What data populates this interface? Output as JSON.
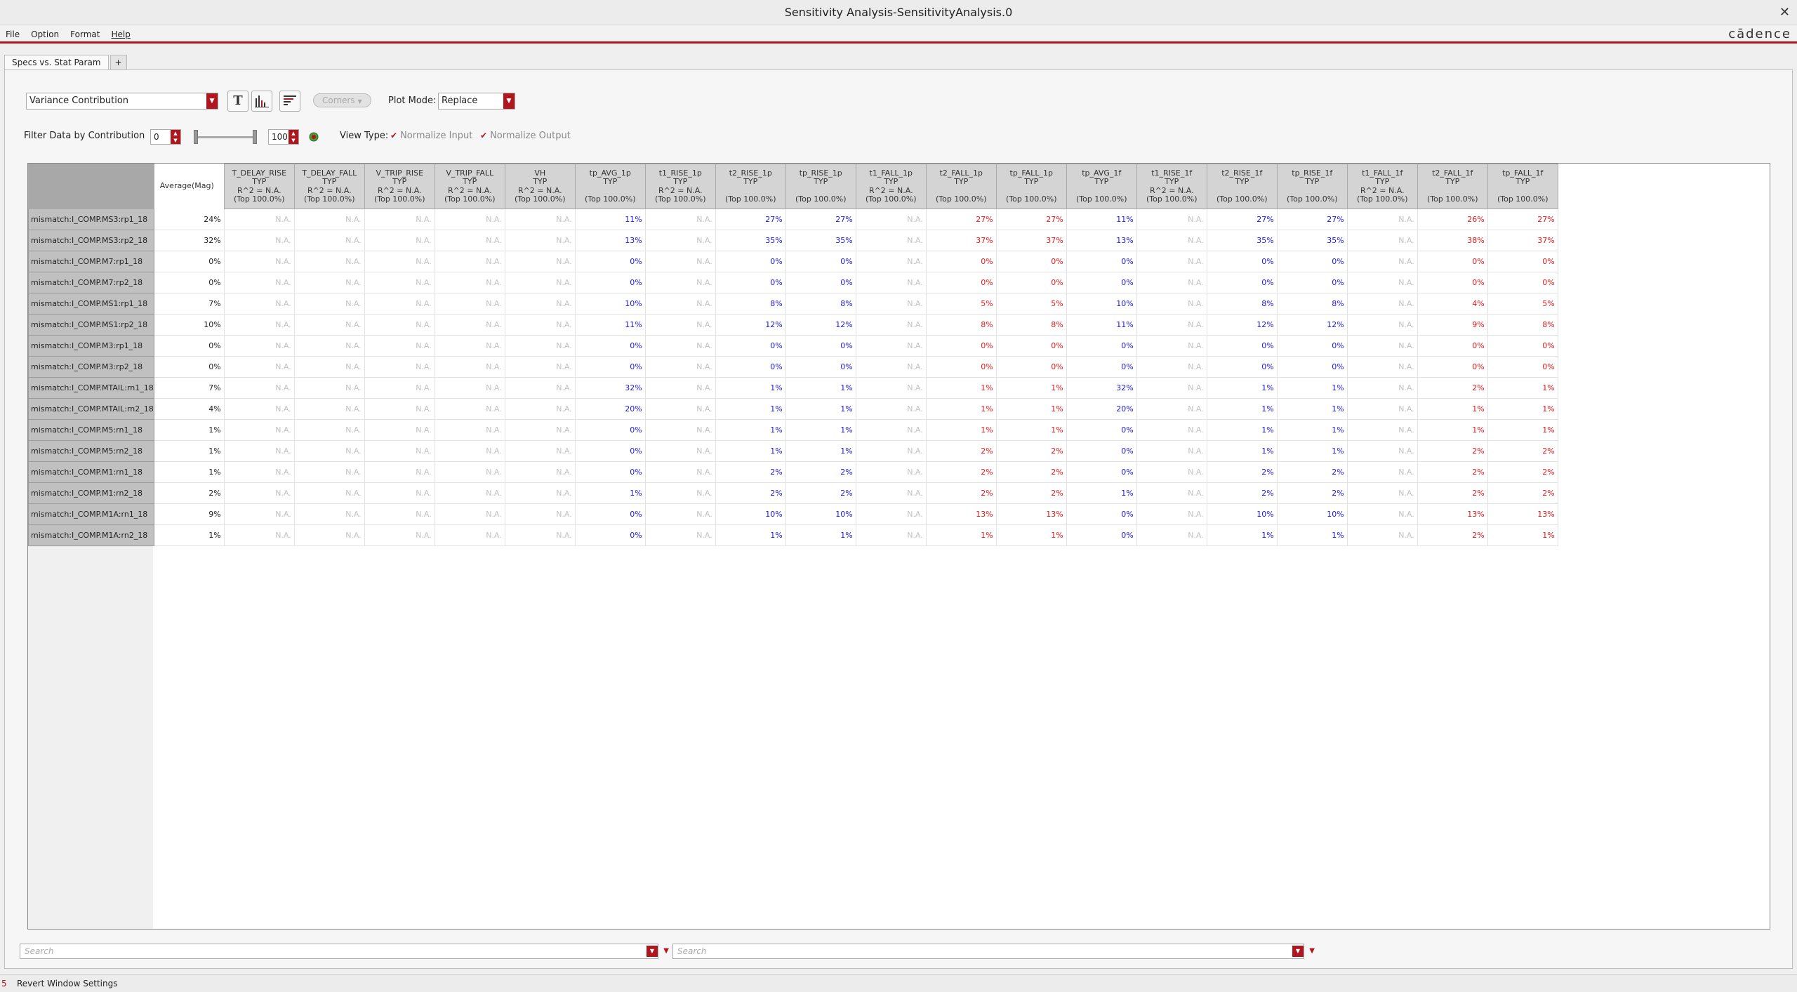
{
  "window": {
    "title": "Sensitivity Analysis-SensitivityAnalysis.0",
    "brand": "cādence"
  },
  "menu": [
    "File",
    "Option",
    "Format",
    "Help"
  ],
  "tabs": [
    "Specs vs. Stat Param",
    "+"
  ],
  "toolbar": {
    "mode_select": "Variance Contribution",
    "corners_label": "Corners",
    "plot_mode_label": "Plot Mode:",
    "plot_mode_value": "Replace",
    "text_view_icon": "T",
    "bar_chart_icon": "bar-chart-icon",
    "sorted_bars_icon": "sorted-bars-icon"
  },
  "filter": {
    "label": "Filter Data  by Contribution",
    "min": "0",
    "max": "100",
    "view_type_label": "View Type:",
    "normalize_input": "Normalize Input",
    "normalize_output": "Normalize Output"
  },
  "grid": {
    "avg_header": "Average(Mag)",
    "columns": [
      {
        "l1": "T_DELAY_RISE",
        "l2": "TYP",
        "l3": "R^2 = N.A.",
        "l4": "(Top 100.0%)"
      },
      {
        "l1": "T_DELAY_FALL",
        "l2": "TYP",
        "l3": "R^2 = N.A.",
        "l4": "(Top 100.0%)"
      },
      {
        "l1": "V_TRIP_RISE",
        "l2": "TYP",
        "l3": "R^2 = N.A.",
        "l4": "(Top 100.0%)"
      },
      {
        "l1": "V_TRIP_FALL",
        "l2": "TYP",
        "l3": "R^2 = N.A.",
        "l4": "(Top 100.0%)"
      },
      {
        "l1": "VH",
        "l2": "TYP",
        "l3": "R^2 = N.A.",
        "l4": "(Top 100.0%)"
      },
      {
        "l1": "tp_AVG_1p",
        "l2": "TYP",
        "l3": "",
        "l4": "(Top 100.0%)"
      },
      {
        "l1": "t1_RISE_1p",
        "l2": "TYP",
        "l3": "R^2 = N.A.",
        "l4": "(Top 100.0%)"
      },
      {
        "l1": "t2_RISE_1p",
        "l2": "TYP",
        "l3": "",
        "l4": "(Top 100.0%)"
      },
      {
        "l1": "tp_RISE_1p",
        "l2": "TYP",
        "l3": "",
        "l4": "(Top 100.0%)"
      },
      {
        "l1": "t1_FALL_1p",
        "l2": "TYP",
        "l3": "R^2 = N.A.",
        "l4": "(Top 100.0%)"
      },
      {
        "l1": "t2_FALL_1p",
        "l2": "TYP",
        "l3": "",
        "l4": "(Top 100.0%)"
      },
      {
        "l1": "tp_FALL_1p",
        "l2": "TYP",
        "l3": "",
        "l4": "(Top 100.0%)"
      },
      {
        "l1": "tp_AVG_1f",
        "l2": "TYP",
        "l3": "",
        "l4": "(Top 100.0%)"
      },
      {
        "l1": "t1_RISE_1f",
        "l2": "TYP",
        "l3": "R^2 = N.A.",
        "l4": "(Top 100.0%)"
      },
      {
        "l1": "t2_RISE_1f",
        "l2": "TYP",
        "l3": "",
        "l4": "(Top 100.0%)"
      },
      {
        "l1": "tp_RISE_1f",
        "l2": "TYP",
        "l3": "",
        "l4": "(Top 100.0%)"
      },
      {
        "l1": "t1_FALL_1f",
        "l2": "TYP",
        "l3": "R^2 = N.A.",
        "l4": "(Top 100.0%)"
      },
      {
        "l1": "t2_FALL_1f",
        "l2": "TYP",
        "l3": "",
        "l4": "(Top 100.0%)"
      },
      {
        "l1": "tp_FALL_1f",
        "l2": "TYP",
        "l3": "",
        "l4": "(Top 100.0%)"
      }
    ],
    "col_colors": [
      "na",
      "na",
      "na",
      "na",
      "na",
      "pos",
      "na",
      "pos",
      "pos",
      "na",
      "neg",
      "neg",
      "pos",
      "na",
      "pos",
      "pos",
      "na",
      "neg",
      "neg"
    ],
    "na_text": "N.A.",
    "rows": [
      {
        "name": "mismatch:I_COMP.MS3:rp1_18",
        "avg": "24%",
        "v": [
          "11%",
          "27%",
          "27%",
          "27%",
          "27%",
          "11%",
          "27%",
          "27%",
          "26%",
          "27%"
        ]
      },
      {
        "name": "mismatch:I_COMP.MS3:rp2_18",
        "avg": "32%",
        "v": [
          "13%",
          "35%",
          "35%",
          "37%",
          "37%",
          "13%",
          "35%",
          "35%",
          "38%",
          "37%"
        ]
      },
      {
        "name": "mismatch:I_COMP.M7:rp1_18",
        "avg": "0%",
        "v": [
          "0%",
          "0%",
          "0%",
          "0%",
          "0%",
          "0%",
          "0%",
          "0%",
          "0%",
          "0%"
        ]
      },
      {
        "name": "mismatch:I_COMP.M7:rp2_18",
        "avg": "0%",
        "v": [
          "0%",
          "0%",
          "0%",
          "0%",
          "0%",
          "0%",
          "0%",
          "0%",
          "0%",
          "0%"
        ]
      },
      {
        "name": "mismatch:I_COMP.MS1:rp1_18",
        "avg": "7%",
        "v": [
          "10%",
          "8%",
          "8%",
          "5%",
          "5%",
          "10%",
          "8%",
          "8%",
          "4%",
          "5%"
        ]
      },
      {
        "name": "mismatch:I_COMP.MS1:rp2_18",
        "avg": "10%",
        "v": [
          "11%",
          "12%",
          "12%",
          "8%",
          "8%",
          "11%",
          "12%",
          "12%",
          "9%",
          "8%"
        ]
      },
      {
        "name": "mismatch:I_COMP.M3:rp1_18",
        "avg": "0%",
        "v": [
          "0%",
          "0%",
          "0%",
          "0%",
          "0%",
          "0%",
          "0%",
          "0%",
          "0%",
          "0%"
        ]
      },
      {
        "name": "mismatch:I_COMP.M3:rp2_18",
        "avg": "0%",
        "v": [
          "0%",
          "0%",
          "0%",
          "0%",
          "0%",
          "0%",
          "0%",
          "0%",
          "0%",
          "0%"
        ]
      },
      {
        "name": "mismatch:I_COMP.MTAIL:rn1_18",
        "avg": "7%",
        "v": [
          "32%",
          "1%",
          "1%",
          "1%",
          "1%",
          "32%",
          "1%",
          "1%",
          "2%",
          "1%"
        ]
      },
      {
        "name": "mismatch:I_COMP.MTAIL:rn2_18",
        "avg": "4%",
        "v": [
          "20%",
          "1%",
          "1%",
          "1%",
          "1%",
          "20%",
          "1%",
          "1%",
          "1%",
          "1%"
        ]
      },
      {
        "name": "mismatch:I_COMP.M5:rn1_18",
        "avg": "1%",
        "v": [
          "0%",
          "1%",
          "1%",
          "1%",
          "1%",
          "0%",
          "1%",
          "1%",
          "1%",
          "1%"
        ]
      },
      {
        "name": "mismatch:I_COMP.M5:rn2_18",
        "avg": "1%",
        "v": [
          "0%",
          "1%",
          "1%",
          "2%",
          "2%",
          "0%",
          "1%",
          "1%",
          "2%",
          "2%"
        ]
      },
      {
        "name": "mismatch:I_COMP.M1:rn1_18",
        "avg": "1%",
        "v": [
          "0%",
          "2%",
          "2%",
          "2%",
          "2%",
          "0%",
          "2%",
          "2%",
          "2%",
          "2%"
        ]
      },
      {
        "name": "mismatch:I_COMP.M1:rn2_18",
        "avg": "2%",
        "v": [
          "1%",
          "2%",
          "2%",
          "2%",
          "2%",
          "1%",
          "2%",
          "2%",
          "2%",
          "2%"
        ]
      },
      {
        "name": "mismatch:I_COMP.M1A:rn1_18",
        "avg": "9%",
        "v": [
          "0%",
          "10%",
          "10%",
          "13%",
          "13%",
          "0%",
          "10%",
          "10%",
          "13%",
          "13%"
        ]
      },
      {
        "name": "mismatch:I_COMP.M1A:rn2_18",
        "avg": "1%",
        "v": [
          "0%",
          "1%",
          "1%",
          "1%",
          "1%",
          "0%",
          "1%",
          "1%",
          "2%",
          "1%"
        ]
      }
    ]
  },
  "search": {
    "left_placeholder": "Search",
    "right_placeholder": "Search"
  },
  "status": {
    "num": "5",
    "message": "Revert Window Settings"
  }
}
